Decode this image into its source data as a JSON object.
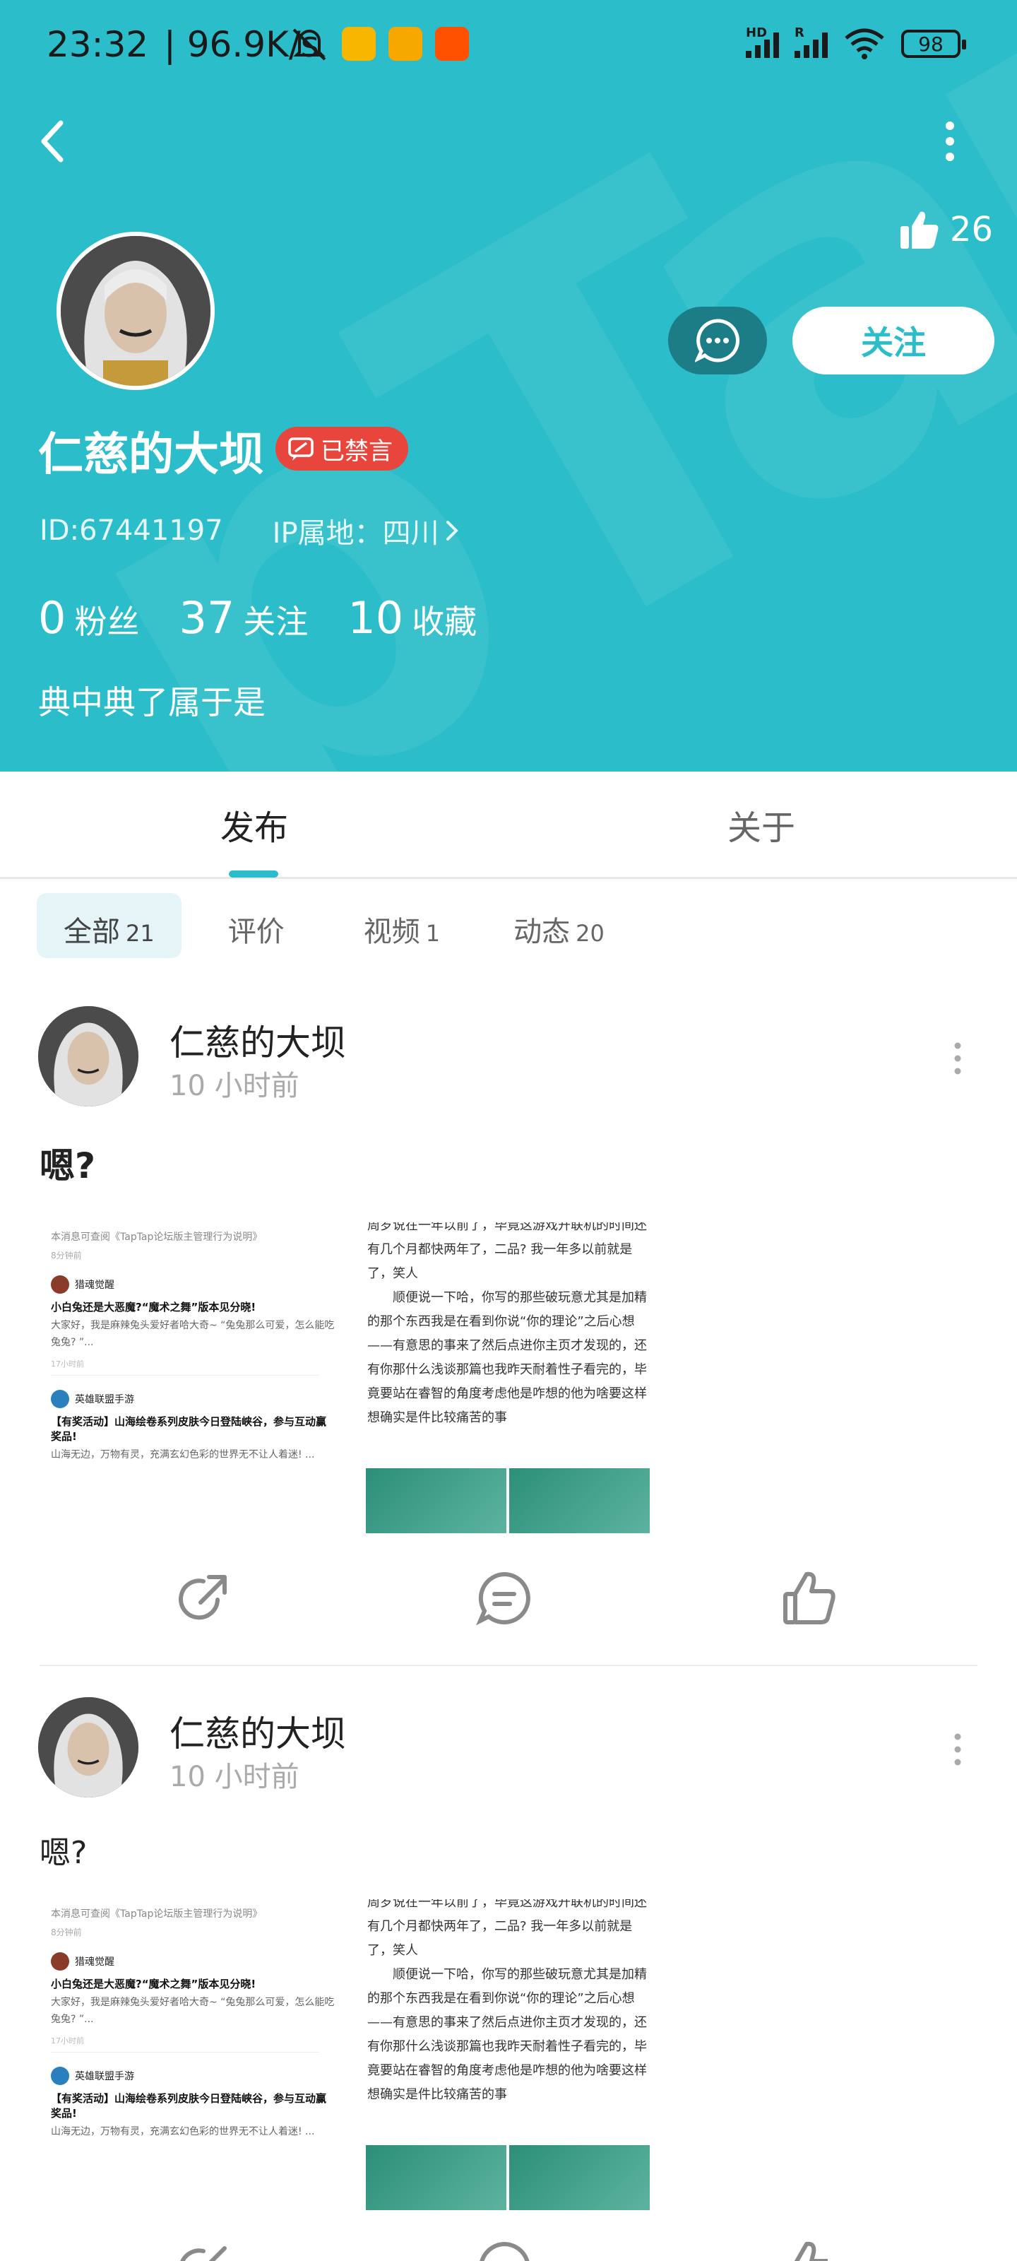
{
  "status_bar": {
    "time": "23:32",
    "net_speed": "| 96.9K/s",
    "battery": "98",
    "hd_label": "HD",
    "r_label": "R"
  },
  "colors": {
    "accent": "#2bbdc9",
    "banned": "#e8453c",
    "message_btn": "#1d7d86"
  },
  "profile": {
    "like_count": "26",
    "follow_label": "关注",
    "username": "仁慈的大坝",
    "banned_label": "已禁言",
    "id": "ID:67441197",
    "ip_location": "IP属地：四川",
    "stats": [
      {
        "num": "0",
        "label": "粉丝"
      },
      {
        "num": "37",
        "label": "关注"
      },
      {
        "num": "10",
        "label": "收藏"
      }
    ],
    "bio": "典中典了属于是"
  },
  "tabs": [
    {
      "label": "发布",
      "active": true
    },
    {
      "label": "关于",
      "active": false
    }
  ],
  "filters": [
    {
      "label": "全部",
      "count": "21",
      "active": true
    },
    {
      "label": "评价",
      "count": "",
      "active": false
    },
    {
      "label": "视频",
      "count": "1",
      "active": false
    },
    {
      "label": "动态",
      "count": "20",
      "active": false
    }
  ],
  "posts": [
    {
      "author": "仁慈的大坝",
      "time": "10 小时前",
      "title": "嗯?",
      "title_bold": true,
      "screenshot_left": {
        "head": "本消息可查阅《TapTap论坛版主管理行为说明》",
        "head_sub": "8分钟前",
        "item1_user": "猎魂觉醒",
        "item1_title": "小白兔还是大恶魔?“魔术之舞”版本见分晓!",
        "item1_body": "大家好，我是麻辣兔头爱好者哈大奇~ “兔兔那么可爱，怎么能吃兔兔? ”...",
        "item1_foot": "17小时前",
        "item2_user": "英雄联盟手游",
        "item2_title": "【有奖活动】山海绘卷系列皮肤今日登陆峡谷，参与互动赢奖品!",
        "item2_body": "山海无边，万物有灵，充满玄幻色彩的世界无不让人着迷! ..."
      },
      "screenshot_right": {
        "line0": "周岁说在一年以前了，毕竟这游戏开联机的时间还",
        "line1": "有几个月都快两年了，二品? 我一年多以前就是了，笑人",
        "para": "顺便说一下哈，你写的那些破玩意尤其是加精的那个东西我是在看到你说“你的理论”之后心想——有意思的事来了然后点进你主页才发现的，还有你那什么浅谈那篇也我昨天耐着性子看完的，毕竟要站在睿智的角度考虑他是咋想的他为啥要这样想确实是件比较痛苦的事"
      }
    },
    {
      "author": "仁慈的大坝",
      "time": "10 小时前",
      "title": "嗯?",
      "title_bold": false,
      "screenshot_left": {
        "head": "本消息可查阅《TapTap论坛版主管理行为说明》",
        "head_sub": "8分钟前",
        "item1_user": "猎魂觉醒",
        "item1_title": "小白兔还是大恶魔?“魔术之舞”版本见分晓!",
        "item1_body": "大家好，我是麻辣兔头爱好者哈大奇~ “兔兔那么可爱，怎么能吃兔兔? ”...",
        "item1_foot": "17小时前",
        "item2_user": "英雄联盟手游",
        "item2_title": "【有奖活动】山海绘卷系列皮肤今日登陆峡谷，参与互动赢奖品!",
        "item2_body": "山海无边，万物有灵，充满玄幻色彩的世界无不让人着迷! ..."
      },
      "screenshot_right": {
        "line0": "周岁说在一年以前了，毕竟这游戏开联机的时间还",
        "line1": "有几个月都快两年了，二品? 我一年多以前就是了，笑人",
        "para": "顺便说一下哈，你写的那些破玩意尤其是加精的那个东西我是在看到你说“你的理论”之后心想——有意思的事来了然后点进你主页才发现的，还有你那什么浅谈那篇也我昨天耐着性子看完的，毕竟要站在睿智的角度考虑他是咋想的他为啥要这样想确实是件比较痛苦的事"
      }
    }
  ]
}
